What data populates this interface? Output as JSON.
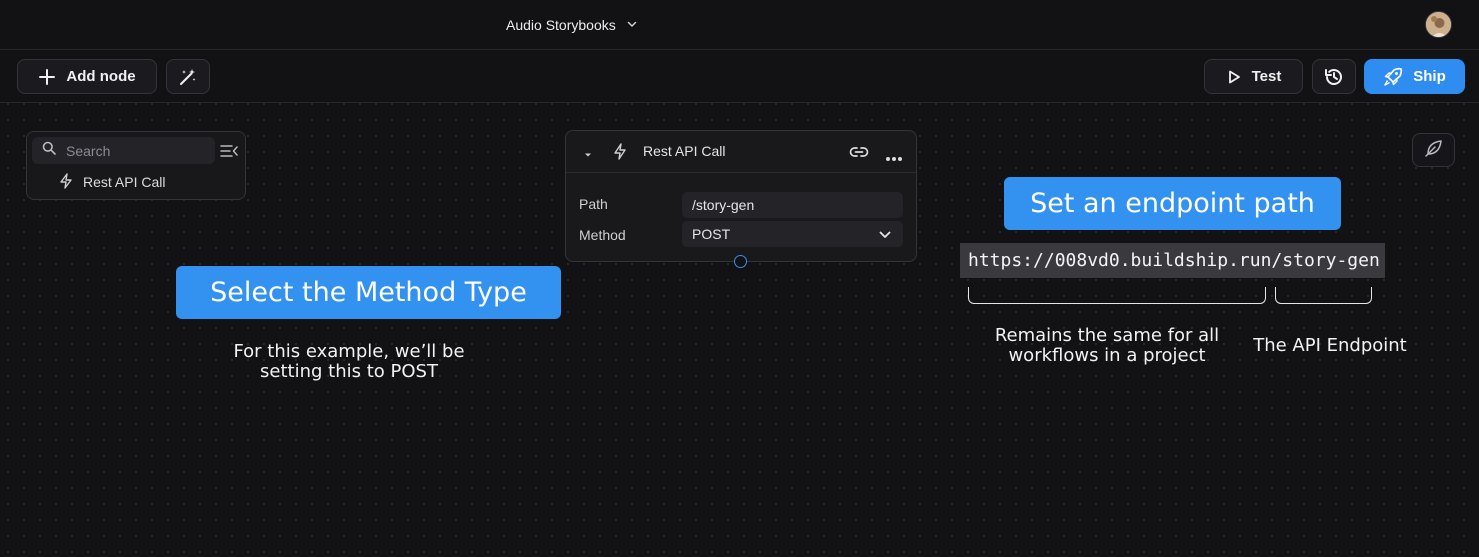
{
  "header": {
    "project_title": "Audio Storybooks"
  },
  "toolbar": {
    "add_node_label": "Add node",
    "test_label": "Test",
    "ship_label": "Ship"
  },
  "side_panel": {
    "search_placeholder": "Search",
    "items": [
      {
        "label": "Rest API Call"
      }
    ]
  },
  "node": {
    "title": "Rest API Call",
    "fields": [
      {
        "label": "Path",
        "value": "/story-gen"
      },
      {
        "label": "Method",
        "value": "POST"
      }
    ]
  },
  "annotations": {
    "method_callout": "Select the Method Type",
    "method_caption_line1": "For this example, we’ll be",
    "method_caption_line2": "setting this to POST",
    "endpoint_callout": "Set an endpoint path",
    "url": "https://008vd0.buildship.run/story-gen",
    "project_caption_line1": "Remains the same for all",
    "project_caption_line2": "workflows in a project",
    "endpoint_caption": "The API Endpoint"
  },
  "colors": {
    "accent": "#2f8cf0",
    "callout": "#3391ef",
    "background": "#121214"
  },
  "icons": {
    "add": "plus-icon",
    "magic": "magic-wand-icon",
    "test": "play-icon",
    "history": "history-icon",
    "ship": "rocket-icon",
    "search": "search-icon",
    "collapse": "collapse-panel-icon",
    "node": "lightning-icon",
    "link": "link-icon",
    "more": "more-icon",
    "dropdown": "chevron-down-icon",
    "corner": "leaf-icon"
  }
}
